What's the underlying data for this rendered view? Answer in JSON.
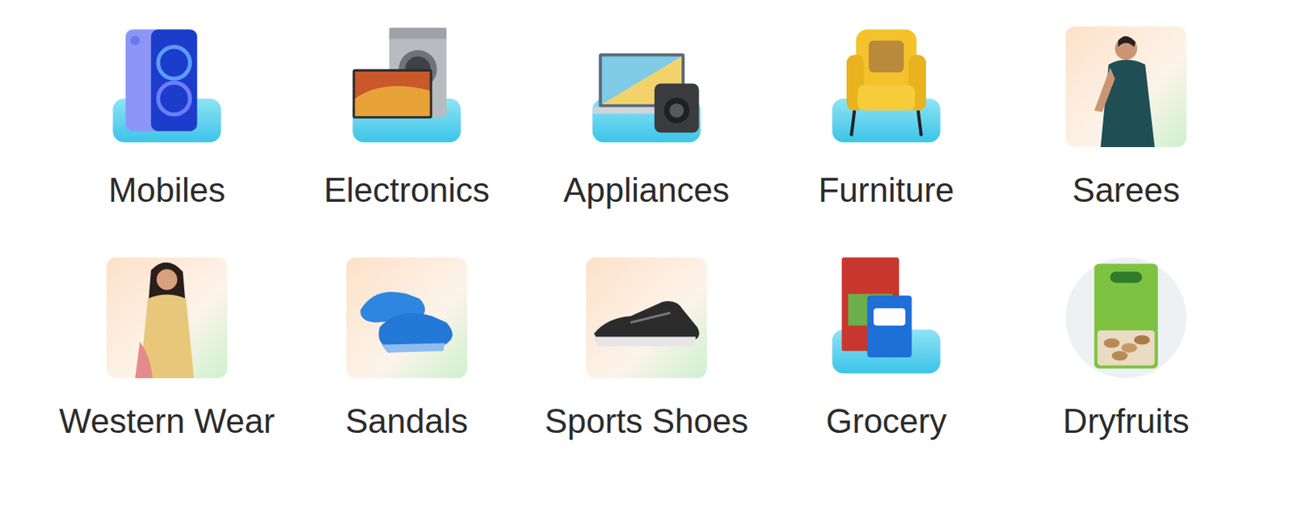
{
  "categories": [
    {
      "label": "Mobiles",
      "kind": "pedestal"
    },
    {
      "label": "Electronics",
      "kind": "pedestal"
    },
    {
      "label": "Appliances",
      "kind": "pedestal"
    },
    {
      "label": "Furniture",
      "kind": "pedestal"
    },
    {
      "label": "Sarees",
      "kind": "tile"
    },
    {
      "label": "Western Wear",
      "kind": "tile"
    },
    {
      "label": "Sandals",
      "kind": "tile"
    },
    {
      "label": "Sports Shoes",
      "kind": "tile"
    },
    {
      "label": "Grocery",
      "kind": "pedestal"
    },
    {
      "label": "Dryfruits",
      "kind": "circle"
    }
  ]
}
